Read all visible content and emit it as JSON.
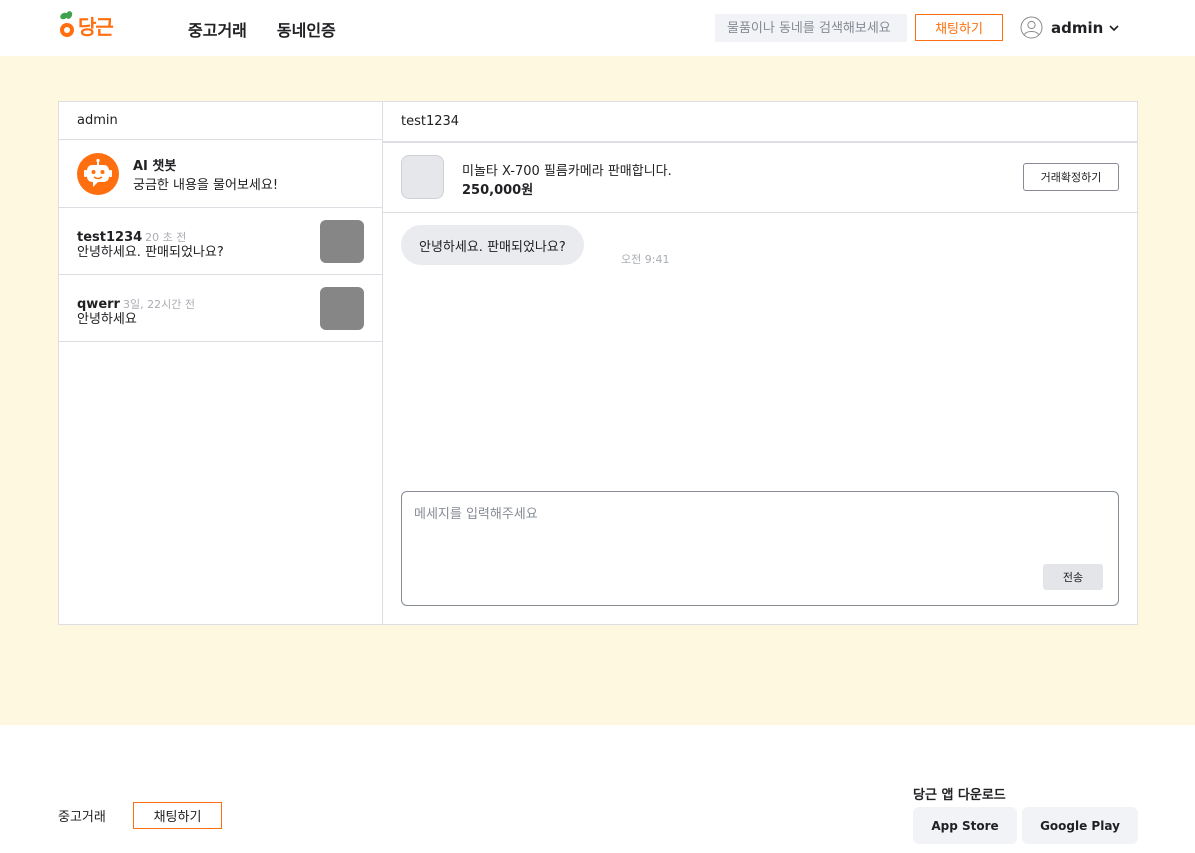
{
  "header": {
    "logo_text": "당근",
    "nav": [
      "중고거래",
      "동네인증"
    ],
    "search_placeholder": "물품이나 동네를 검색해보세요",
    "chat_button": "채팅하기",
    "user_name": "admin",
    "accent_color": "#ff6f0f"
  },
  "chat_list": {
    "owner": "admin",
    "bot": {
      "title": "AI 챗봇",
      "subtitle": "궁금한 내용을 물어보세요!"
    },
    "rooms": [
      {
        "name": "test1234",
        "time": "20 초 전",
        "last_message": "안녕하세요. 판매되었나요?"
      },
      {
        "name": "qwerr",
        "time": "3일, 22시간 전",
        "last_message": "안녕하세요"
      }
    ]
  },
  "chat_room": {
    "partner": "test1234",
    "product": {
      "title": "미놀타 X-700 필름카메라 판매합니다.",
      "price": "250,000원"
    },
    "confirm_button": "거래확정하기",
    "messages": [
      {
        "text": "안녕하세요. 판매되었나요?",
        "time": "오전 9:41"
      }
    ],
    "input_placeholder": "메세지를 입력해주세요",
    "send_button": "전송"
  },
  "footer": {
    "link": "중고거래",
    "chat_button": "채팅하기",
    "download_title": "당근 앱 다운로드",
    "app_store": "App Store",
    "google_play": "Google Play"
  }
}
